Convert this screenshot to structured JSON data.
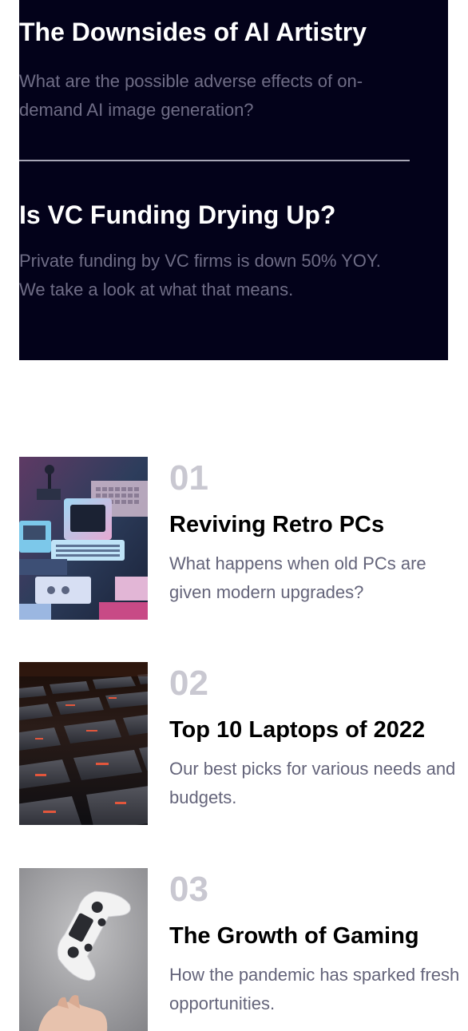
{
  "featured": [
    {
      "title": "The Downsides of AI Artistry",
      "description": "What are the possible adverse effects of on-demand AI image generation?"
    },
    {
      "title": "Is VC Funding Drying Up?",
      "description": "Private funding by VC firms is down 50% YOY. We take a look at what that means."
    }
  ],
  "articles": [
    {
      "number": "01",
      "title": "Reviving Retro PCs",
      "description": "What happens when old PCs are given modern upgrades?",
      "image_icon": "retro-pc-photo"
    },
    {
      "number": "02",
      "title": "Top 10 Laptops of 2022",
      "description": "Our best picks for various needs and budgets.",
      "image_icon": "laptop-keyboard-photo"
    },
    {
      "number": "03",
      "title": "The Growth of Gaming",
      "description": "How the pandemic has sparked fresh opportunities.",
      "image_icon": "game-controller-photo"
    }
  ],
  "colors": {
    "panel_background": "#03021a",
    "feature_title": "#ffffff",
    "feature_description": "#6f6d86",
    "article_number": "#c9c8d1",
    "article_title": "#000000",
    "article_description": "#64647a"
  }
}
